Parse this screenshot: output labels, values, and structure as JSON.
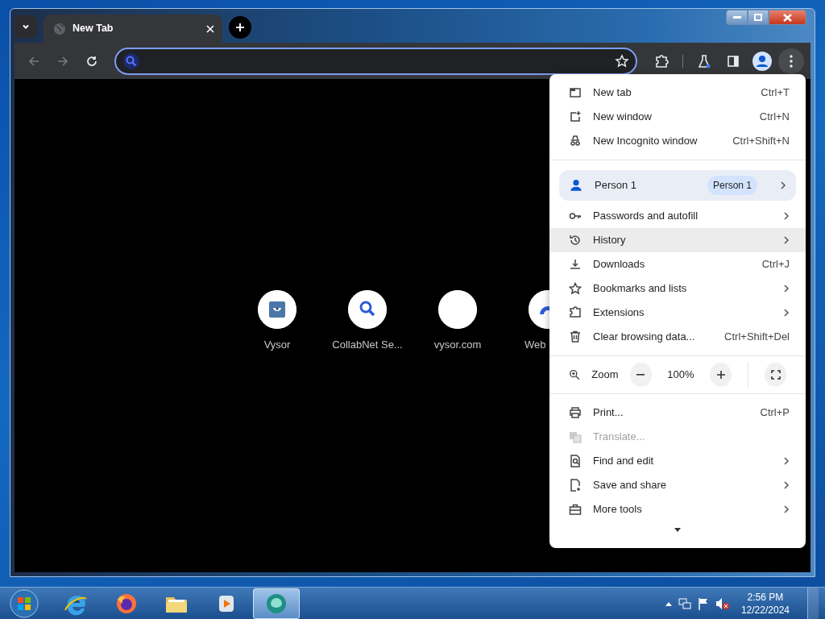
{
  "tabs": [
    {
      "title": "New Tab",
      "selected": true
    }
  ],
  "shortcuts": [
    {
      "label": "Vysor",
      "kind": "vysor"
    },
    {
      "label": "CollabNet Se...",
      "kind": "search"
    },
    {
      "label": "vysor.com",
      "kind": "blank"
    },
    {
      "label": "Web",
      "kind": "web",
      "cut": true
    }
  ],
  "menu": {
    "sections": [
      [
        {
          "kind": "newtab",
          "label": "New tab",
          "shortcut": "Ctrl+T",
          "submenu": false,
          "selected": false,
          "disabled": false
        },
        {
          "kind": "newwindow",
          "label": "New window",
          "shortcut": "Ctrl+N",
          "submenu": false,
          "selected": false,
          "disabled": false
        },
        {
          "kind": "incognito",
          "label": "New Incognito window",
          "shortcut": "Ctrl+Shift+N",
          "submenu": false,
          "selected": false,
          "disabled": false
        }
      ],
      [
        {
          "kind": "profile",
          "label": "Person 1",
          "badge": "Person 1",
          "submenu": true,
          "selected": false,
          "disabled": false
        },
        {
          "kind": "key",
          "label": "Passwords and autofill",
          "submenu": true,
          "selected": false,
          "disabled": false
        },
        {
          "kind": "history",
          "label": "History",
          "submenu": true,
          "selected": true,
          "disabled": false
        },
        {
          "kind": "download",
          "label": "Downloads",
          "shortcut": "Ctrl+J",
          "submenu": false,
          "selected": false,
          "disabled": false
        },
        {
          "kind": "star",
          "label": "Bookmarks and lists",
          "submenu": true,
          "selected": false,
          "disabled": false
        },
        {
          "kind": "puzzle",
          "label": "Extensions",
          "submenu": true,
          "selected": false,
          "disabled": false
        },
        {
          "kind": "trash",
          "label": "Clear browsing data...",
          "shortcut": "Ctrl+Shift+Del",
          "submenu": false,
          "selected": false,
          "disabled": false
        }
      ],
      [
        {
          "kind": "zoom",
          "label": "Zoom",
          "value": "100%"
        }
      ],
      [
        {
          "kind": "print",
          "label": "Print...",
          "shortcut": "Ctrl+P",
          "submenu": false,
          "selected": false,
          "disabled": false
        },
        {
          "kind": "translate",
          "label": "Translate...",
          "submenu": false,
          "selected": false,
          "disabled": true
        },
        {
          "kind": "find",
          "label": "Find and edit",
          "submenu": true,
          "selected": false,
          "disabled": false
        },
        {
          "kind": "save",
          "label": "Save and share",
          "submenu": true,
          "selected": false,
          "disabled": false
        },
        {
          "kind": "tools",
          "label": "More tools",
          "submenu": true,
          "selected": false,
          "disabled": false
        }
      ]
    ]
  },
  "taskbar": {
    "apps": [
      {
        "kind": "ie",
        "selected": false
      },
      {
        "kind": "firefox",
        "selected": false
      },
      {
        "kind": "folder",
        "selected": false
      },
      {
        "kind": "media",
        "selected": false
      },
      {
        "kind": "vysor",
        "selected": true
      }
    ],
    "time": "2:56 PM",
    "date": "12/22/2024"
  }
}
